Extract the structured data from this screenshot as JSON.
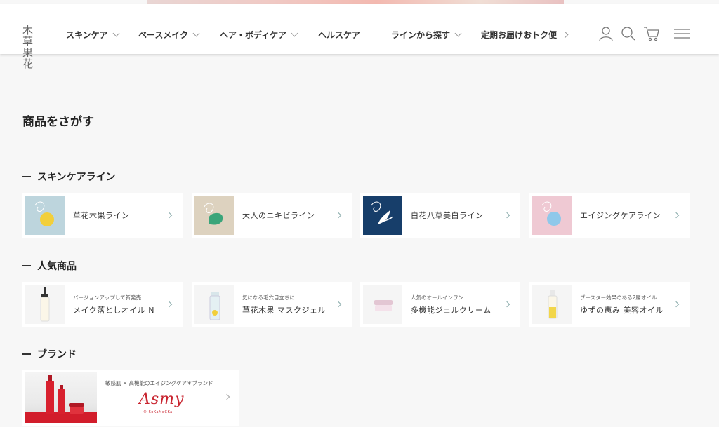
{
  "header": {
    "logo_line1": "木 草",
    "logo_line2": "果 花",
    "nav": [
      {
        "label": "スキンケア"
      },
      {
        "label": "ベースメイク"
      },
      {
        "label": "ヘア・ボディケア"
      },
      {
        "label": "ヘルスケア"
      },
      {
        "label": "ラインから探す"
      },
      {
        "label": "定期お届けおトク便"
      }
    ],
    "icons": [
      "user-icon",
      "search-icon",
      "cart-icon",
      "menu-icon"
    ]
  },
  "page": {
    "title": "商品をさがす",
    "sections": {
      "lines": {
        "title": "スキンケアライン",
        "items": [
          {
            "label": "草花木果ライン",
            "thumb_bg": "#bdd5dd",
            "accent": "#f2cf3a"
          },
          {
            "label": "大人のニキビライン",
            "thumb_bg": "#ddd2bf",
            "accent": "#3aa57a"
          },
          {
            "label": "白花八草美白ライン",
            "thumb_bg": "#173e6a",
            "accent": "#ffffff"
          },
          {
            "label": "エイジングケアライン",
            "thumb_bg": "#efc9d3",
            "accent": "#8fc8ea"
          }
        ]
      },
      "popular": {
        "title": "人気商品",
        "items": [
          {
            "sub": "バージョンアップして新発売",
            "name": "メイク落としオイル N"
          },
          {
            "sub": "気になる毛穴目立ちに",
            "name": "草花木果 マスクジェル"
          },
          {
            "sub": "人気のオールインワン",
            "name": "多機能ジェルクリーム"
          },
          {
            "sub": "ブースター効果のある2層オイル",
            "name": "ゆずの恵み 美容オイル"
          }
        ]
      },
      "brand": {
        "title": "ブランド",
        "caption": "敏感肌 × 高機能のエイジングケア＊ブランド",
        "logo": "Asmy",
        "logo_sub": "® SoKaMoCKa"
      }
    }
  },
  "colors": {
    "brand_red": "#c8232e",
    "background": "#f7f7f7"
  }
}
